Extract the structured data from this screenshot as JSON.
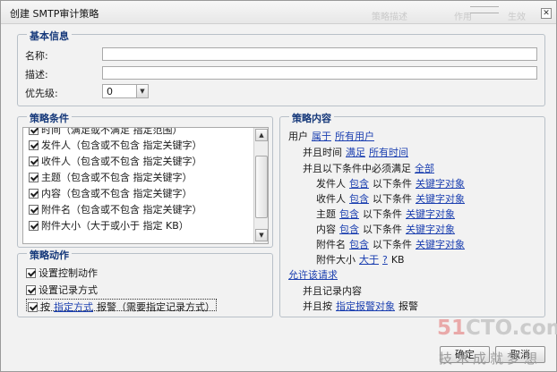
{
  "window": {
    "title": "创建 SMTP审计策略",
    "ghost_texts": [
      "策略描述",
      "作用",
      "生效"
    ],
    "close_label": "✕"
  },
  "basic_info": {
    "legend": "基本信息",
    "name_label": "名称:",
    "name_value": "",
    "desc_label": "描述:",
    "desc_value": "",
    "priority_label": "优先级:",
    "priority_value": "0"
  },
  "conditions": {
    "legend": "策略条件",
    "items": [
      "时间（满足或不满足 指定范围）",
      "发件人（包含或不包含 指定关键字）",
      "收件人（包含或不包含 指定关键字）",
      "主题（包含或不包含 指定关键字）",
      "内容（包含或不包含 指定关键字）",
      "附件名（包含或不包含 指定关键字）",
      "附件大小（大于或小于 指定 KB）"
    ]
  },
  "actions": {
    "legend": "策略动作",
    "items": [
      {
        "text": "设置控制动作"
      },
      {
        "text": "设置记录方式"
      },
      {
        "prefix": "按",
        "link": "指定方式",
        "suffix": "报警（需要指定记录方式）"
      }
    ]
  },
  "content": {
    "legend": "策略内容",
    "user": {
      "label": "用户",
      "link1": "属于",
      "link2": "所有用户"
    },
    "time": {
      "label": "并且时间",
      "link1": "满足",
      "link2": "所有时间"
    },
    "must": {
      "label": "并且以下条件中必须满足",
      "link": "全部"
    },
    "rows": [
      {
        "label": "发件人",
        "link1": "包含",
        "mid": "以下条件",
        "link2": "关键字对象"
      },
      {
        "label": "收件人",
        "link1": "包含",
        "mid": "以下条件",
        "link2": "关键字对象"
      },
      {
        "label": "主题",
        "link1": "包含",
        "mid": "以下条件",
        "link2": "关键字对象"
      },
      {
        "label": "内容",
        "link1": "包含",
        "mid": "以下条件",
        "link2": "关键字对象"
      },
      {
        "label": "附件名",
        "link1": "包含",
        "mid": "以下条件",
        "link2": "关键字对象"
      }
    ],
    "size": {
      "label": "附件大小",
      "link1": "大于",
      "link2": "?",
      "unit": "KB"
    },
    "allow": "允许该请求",
    "record": "并且记录内容",
    "alarm": {
      "label": "并且按",
      "link": "指定报警对象",
      "suffix": "报警"
    }
  },
  "buttons": {
    "ok": "确定",
    "cancel": "取消"
  },
  "watermark": {
    "brand_a": "51",
    "brand_b": "CTO.com",
    "slogan": "技术成就梦想"
  }
}
